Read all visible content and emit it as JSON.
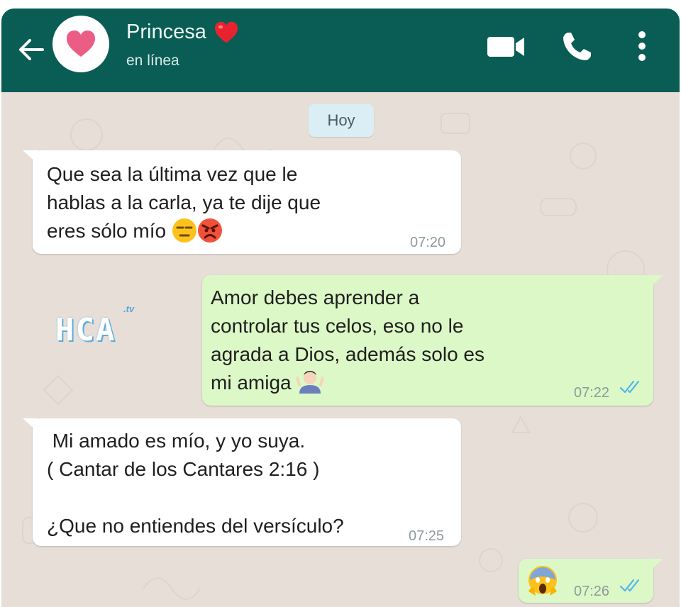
{
  "header": {
    "contact_name": "Princesa",
    "status": "en línea",
    "back_icon": "arrow-left-icon",
    "avatar_icon": "heart-icon",
    "video_icon": "video-camera-icon",
    "call_icon": "phone-icon",
    "menu_icon": "more-vertical-icon",
    "bg_color": "#0a5d54"
  },
  "chat": {
    "date_chip": "Hoy",
    "watermark": "HCA",
    "watermark_small": ".tv",
    "messages": [
      {
        "direction": "incoming",
        "lines": [
          "Que sea la última vez que le",
          "hablas a la carla, ya te dije que",
          "eres sólo mío"
        ],
        "emojis": [
          "expressionless-face-emoji",
          "angry-face-emoji"
        ],
        "time": "07:20"
      },
      {
        "direction": "outgoing",
        "lines": [
          "Amor debes aprender a",
          "controlar tus celos, eso no le",
          "agrada a Dios, además solo es",
          "mi amiga"
        ],
        "emojis": [
          "person-shrugging-emoji"
        ],
        "time": "07:22",
        "status": "read"
      },
      {
        "direction": "incoming",
        "lines": [
          " Mi amado es mío, y yo suya.",
          "( Cantar de los Cantares 2:16 )",
          "",
          "¿Que no entiendes del versículo?"
        ],
        "time": "07:25"
      },
      {
        "direction": "outgoing",
        "lines": [],
        "emojis": [
          "face-screaming-in-fear-emoji"
        ],
        "time": "07:26",
        "status": "read"
      }
    ],
    "colors": {
      "incoming_bubble": "#ffffff",
      "outgoing_bubble": "#dcf8c6",
      "read_ticks": "#4fb6ec"
    }
  }
}
